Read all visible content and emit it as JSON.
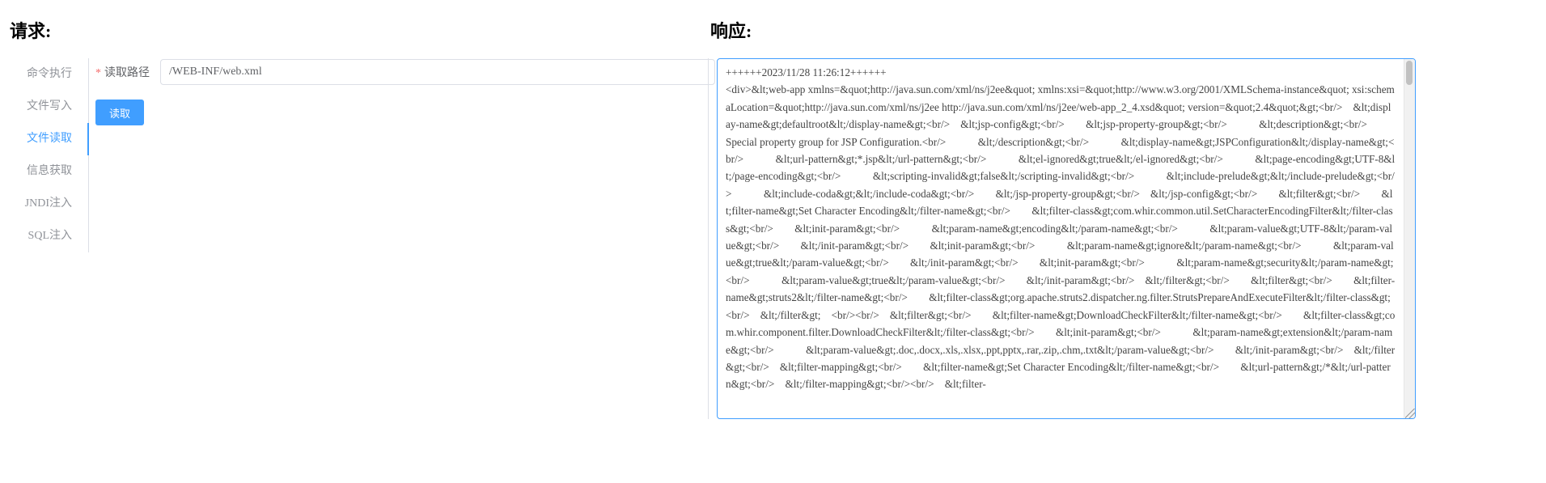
{
  "request": {
    "title": "请求:",
    "nav": [
      {
        "label": "命令执行",
        "active": false
      },
      {
        "label": "文件写入",
        "active": false
      },
      {
        "label": "文件读取",
        "active": true
      },
      {
        "label": "信息获取",
        "active": false
      },
      {
        "label": "JNDI注入",
        "active": false
      },
      {
        "label": "SQL注入",
        "active": false
      }
    ],
    "path_label": "读取路径",
    "required_mark": "*",
    "path_value": "/WEB-INF/web.xml",
    "read_button": "读取"
  },
  "response": {
    "title": "响应:",
    "text": "++++++2023/11/28 11:26:12++++++\n<div>&lt;web-app xmlns=&quot;http://java.sun.com/xml/ns/j2ee&quot; xmlns:xsi=&quot;http://www.w3.org/2001/XMLSchema-instance&quot; xsi:schemaLocation=&quot;http://java.sun.com/xml/ns/j2ee http://java.sun.com/xml/ns/j2ee/web-app_2_4.xsd&quot; version=&quot;2.4&quot;&gt;<br/>    &lt;display-name&gt;defaultroot&lt;/display-name&gt;<br/>    &lt;jsp-config&gt;<br/>        &lt;jsp-property-group&gt;<br/>            &lt;description&gt;<br/>              Special property group for JSP Configuration.<br/>            &lt;/description&gt;<br/>            &lt;display-name&gt;JSPConfiguration&lt;/display-name&gt;<br/>            &lt;url-pattern&gt;*.jsp&lt;/url-pattern&gt;<br/>            &lt;el-ignored&gt;true&lt;/el-ignored&gt;<br/>            &lt;page-encoding&gt;UTF-8&lt;/page-encoding&gt;<br/>            &lt;scripting-invalid&gt;false&lt;/scripting-invalid&gt;<br/>            &lt;include-prelude&gt;&lt;/include-prelude&gt;<br/>            &lt;include-coda&gt;&lt;/include-coda&gt;<br/>        &lt;/jsp-property-group&gt;<br/>    &lt;/jsp-config&gt;<br/>        &lt;filter&gt;<br/>        &lt;filter-name&gt;Set Character Encoding&lt;/filter-name&gt;<br/>        &lt;filter-class&gt;com.whir.common.util.SetCharacterEncodingFilter&lt;/filter-class&gt;<br/>        &lt;init-param&gt;<br/>            &lt;param-name&gt;encoding&lt;/param-name&gt;<br/>            &lt;param-value&gt;UTF-8&lt;/param-value&gt;<br/>        &lt;/init-param&gt;<br/>        &lt;init-param&gt;<br/>            &lt;param-name&gt;ignore&lt;/param-name&gt;<br/>            &lt;param-value&gt;true&lt;/param-value&gt;<br/>        &lt;/init-param&gt;<br/>        &lt;init-param&gt;<br/>            &lt;param-name&gt;security&lt;/param-name&gt;<br/>            &lt;param-value&gt;true&lt;/param-value&gt;<br/>        &lt;/init-param&gt;<br/>    &lt;/filter&gt;<br/>        &lt;filter&gt;<br/>        &lt;filter-name&gt;struts2&lt;/filter-name&gt;<br/>        &lt;filter-class&gt;org.apache.struts2.dispatcher.ng.filter.StrutsPrepareAndExecuteFilter&lt;/filter-class&gt;<br/>    &lt;/filter&gt;    <br/><br/>    &lt;filter&gt;<br/>        &lt;filter-name&gt;DownloadCheckFilter&lt;/filter-name&gt;<br/>        &lt;filter-class&gt;com.whir.component.filter.DownloadCheckFilter&lt;/filter-class&gt;<br/>        &lt;init-param&gt;<br/>            &lt;param-name&gt;extension&lt;/param-name&gt;<br/>            &lt;param-value&gt;.doc,.docx,.xls,.xlsx,.ppt,pptx,.rar,.zip,.chm,.txt&lt;/param-value&gt;<br/>        &lt;/init-param&gt;<br/>    &lt;/filter&gt;<br/>    &lt;filter-mapping&gt;<br/>        &lt;filter-name&gt;Set Character Encoding&lt;/filter-name&gt;<br/>        &lt;url-pattern&gt;/*&lt;/url-pattern&gt;<br/>    &lt;/filter-mapping&gt;<br/><br/>    &lt;filter-"
  }
}
